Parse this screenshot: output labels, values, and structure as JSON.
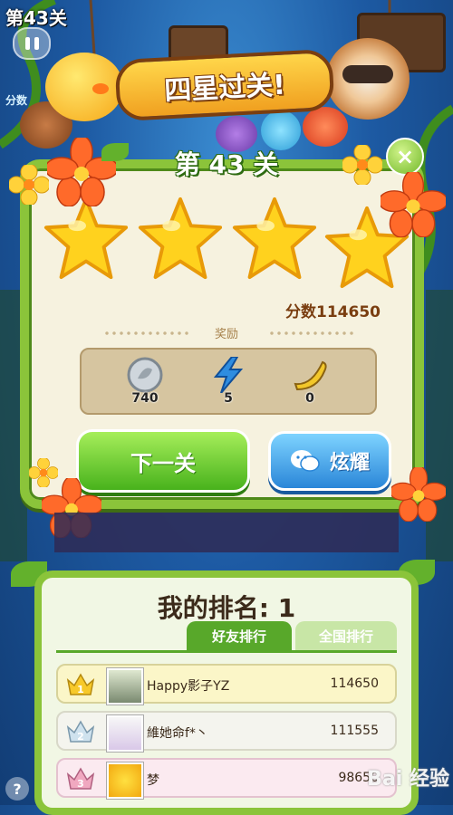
{
  "hud": {
    "level_label": "第43关",
    "score_label": "分数"
  },
  "banner": {
    "text": "四星过关!"
  },
  "panel": {
    "title": "第 43 关",
    "close_glyph": "×",
    "stars_earned": 4,
    "stars_total": 4,
    "score_text": "分数114650",
    "reward_title": "奖励",
    "rewards": [
      {
        "icon": "silver-coin-icon",
        "value": "740"
      },
      {
        "icon": "lightning-icon",
        "value": "5"
      },
      {
        "icon": "banana-icon",
        "value": "0"
      }
    ],
    "next_button": "下一关",
    "share_button": "炫耀"
  },
  "ranking": {
    "title": "我的排名: 1",
    "tabs": [
      "好友排行",
      "全国排行"
    ],
    "active_tab": 0,
    "rows": [
      {
        "rank": "1",
        "name": "Happy影子YZ",
        "score": "114650"
      },
      {
        "rank": "2",
        "name": "維她命f*丶",
        "score": "111555"
      },
      {
        "rank": "3",
        "name": "梦",
        "score": "98650"
      }
    ]
  },
  "help": "?",
  "watermark": "Bai 经验",
  "colors": {
    "panel_border": "#8bc43a",
    "next_button": "#48b21c",
    "share_button": "#2a86d8",
    "star": "#ffd21e"
  }
}
